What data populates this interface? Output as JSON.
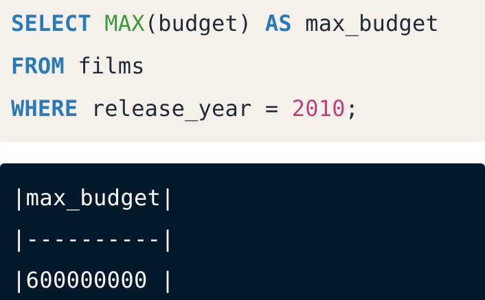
{
  "code": {
    "line1": {
      "kw_select": "SELECT",
      "fn_max": "MAX",
      "arg": "(budget)",
      "kw_as": "AS",
      "alias": "max_budget"
    },
    "line2": {
      "kw_from": "FROM",
      "table": "films"
    },
    "line3": {
      "kw_where": "WHERE",
      "condition": "release_year =",
      "value": "2010",
      "terminator": ";"
    }
  },
  "result": {
    "header": "|max_budget|",
    "separator": "|----------|",
    "row": "|600000000 |"
  },
  "colors": {
    "code_background": "#f5f1ea",
    "result_background": "#05192d",
    "keyword": "#2b7ab8",
    "function": "#3a9a3a",
    "number": "#c0407a"
  }
}
